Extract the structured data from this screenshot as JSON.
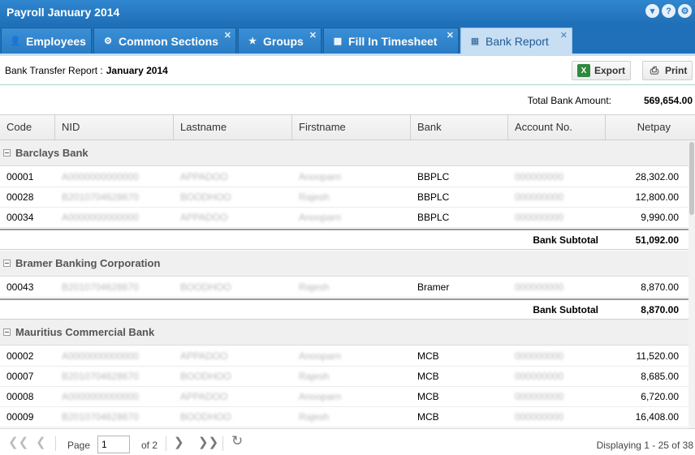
{
  "window": {
    "title": "Payroll January 2014",
    "tool_icons": [
      "chevron-down-icon",
      "help-icon",
      "gear-icon"
    ]
  },
  "tabs": [
    {
      "label": "Employees",
      "icon": "employee-icon",
      "closable": false,
      "active": false
    },
    {
      "label": "Common Sections",
      "icon": "sections-icon",
      "closable": true,
      "active": false
    },
    {
      "label": "Groups",
      "icon": "groups-icon",
      "closable": true,
      "active": false
    },
    {
      "label": "Fill In Timesheet",
      "icon": "timesheet-icon",
      "closable": true,
      "active": false
    },
    {
      "label": "Bank Report",
      "icon": "bank-report-icon",
      "closable": true,
      "active": true
    }
  ],
  "toolbar": {
    "report_label": "Bank Transfer Report :",
    "report_period": "January 2014",
    "export_label": "Export",
    "print_label": "Print"
  },
  "summary": {
    "total_label": "Total Bank Amount:",
    "total_value": "569,654.00"
  },
  "columns": [
    "Code",
    "NID",
    "Lastname",
    "Firstname",
    "Bank",
    "Account No.",
    "Netpay"
  ],
  "groups": [
    {
      "name": "Barclays Bank",
      "rows": [
        {
          "code": "00001",
          "nid": "A0000000000000",
          "lastname": "APPADOO",
          "firstname": "Anooparn",
          "bank": "BBPLC",
          "account": "000000000",
          "netpay": "28,302.00"
        },
        {
          "code": "00028",
          "nid": "B2010704628670",
          "lastname": "BOODHOO",
          "firstname": "Rajesh",
          "bank": "BBPLC",
          "account": "000000000",
          "netpay": "12,800.00"
        },
        {
          "code": "00034",
          "nid": "A0000000000000",
          "lastname": "APPADOO",
          "firstname": "Anooparn",
          "bank": "BBPLC",
          "account": "000000000",
          "netpay": "9,990.00"
        }
      ],
      "subtotal_label": "Bank Subtotal",
      "subtotal": "51,092.00"
    },
    {
      "name": "Bramer Banking Corporation",
      "rows": [
        {
          "code": "00043",
          "nid": "B2010704628670",
          "lastname": "BOODHOO",
          "firstname": "Rajesh",
          "bank": "Bramer",
          "account": "000000000",
          "netpay": "8,870.00"
        }
      ],
      "subtotal_label": "Bank Subtotal",
      "subtotal": "8,870.00"
    },
    {
      "name": "Mauritius Commercial Bank",
      "rows": [
        {
          "code": "00002",
          "nid": "A0000000000000",
          "lastname": "APPADOO",
          "firstname": "Anooparn",
          "bank": "MCB",
          "account": "000000000",
          "netpay": "11,520.00"
        },
        {
          "code": "00007",
          "nid": "B2010704628670",
          "lastname": "BOODHOO",
          "firstname": "Rajesh",
          "bank": "MCB",
          "account": "000000000",
          "netpay": "8,685.00"
        },
        {
          "code": "00008",
          "nid": "A0000000000000",
          "lastname": "APPADOO",
          "firstname": "Anooparn",
          "bank": "MCB",
          "account": "000000000",
          "netpay": "6,720.00"
        },
        {
          "code": "00009",
          "nid": "B2010704628670",
          "lastname": "BOODHOO",
          "firstname": "Rajesh",
          "bank": "MCB",
          "account": "000000000",
          "netpay": "16,408.00"
        }
      ]
    }
  ],
  "pager": {
    "page_label": "Page",
    "current_page": "1",
    "of_label": "of 2",
    "display_text": "Displaying 1 - 25 of 38"
  }
}
